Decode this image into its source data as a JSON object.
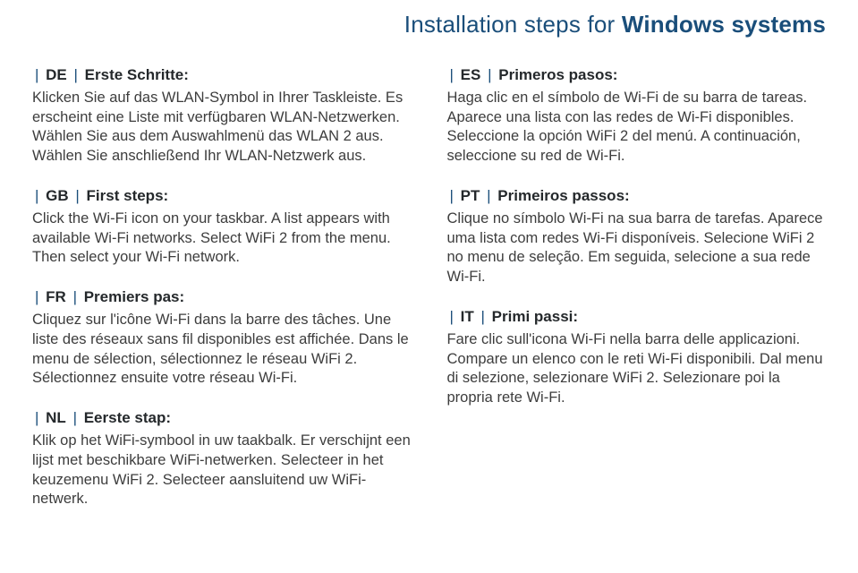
{
  "title": {
    "prefix": "Installation steps for ",
    "emphasis": "Windows systems"
  },
  "left": [
    {
      "lang": "DE",
      "label": "Erste Schritte:",
      "body": "Klicken Sie auf das WLAN-Symbol in Ihrer Taskleiste. Es erscheint eine Liste mit verfügbaren WLAN-Netzwerken. Wählen Sie aus dem Auswahlmenü das WLAN 2 aus. Wählen Sie anschließend Ihr WLAN-Netzwerk aus."
    },
    {
      "lang": "GB",
      "label": "First steps:",
      "body": "Click the Wi-Fi icon on your taskbar. A list appears with available Wi-Fi networks. Select WiFi 2 from the menu. Then select your Wi-Fi network."
    },
    {
      "lang": "FR",
      "label": "Premiers pas:",
      "body": "Cliquez sur l'icône Wi-Fi dans la barre des tâches. Une liste des réseaux sans fil disponibles est affichée. Dans le menu de sélection, sélectionnez le réseau WiFi 2. Sélectionnez ensuite votre réseau Wi-Fi."
    },
    {
      "lang": "NL",
      "label": "Eerste stap:",
      "body": "Klik op het WiFi-symbool in uw taakbalk. Er verschijnt een lijst met beschikbare WiFi-netwerken. Selecteer in het keuzemenu WiFi 2. Selecteer aansluitend uw WiFi-netwerk."
    }
  ],
  "right": [
    {
      "lang": "ES",
      "label": "Primeros pasos:",
      "body": "Haga clic en el símbolo de Wi-Fi de su barra de tareas. Aparece una lista con las redes de Wi-Fi disponibles. Seleccione la opción WiFi 2 del menú. A continuación, seleccione su red de Wi-Fi."
    },
    {
      "lang": "PT",
      "label": "Primeiros passos:",
      "body": "Clique no símbolo Wi-Fi na sua barra de tarefas. Aparece uma lista com redes Wi-Fi disponíveis. Selecione WiFi 2 no menu de seleção. Em seguida, selecione a sua rede Wi-Fi."
    },
    {
      "lang": "IT",
      "label": "Primi passi:",
      "body": "Fare clic sull'icona Wi-Fi nella barra delle applicazioni. Compare un elenco con le reti Wi-Fi disponibili. Dal menu di selezione, selezionare WiFi 2. Selezionare poi la propria rete Wi-Fi."
    }
  ]
}
